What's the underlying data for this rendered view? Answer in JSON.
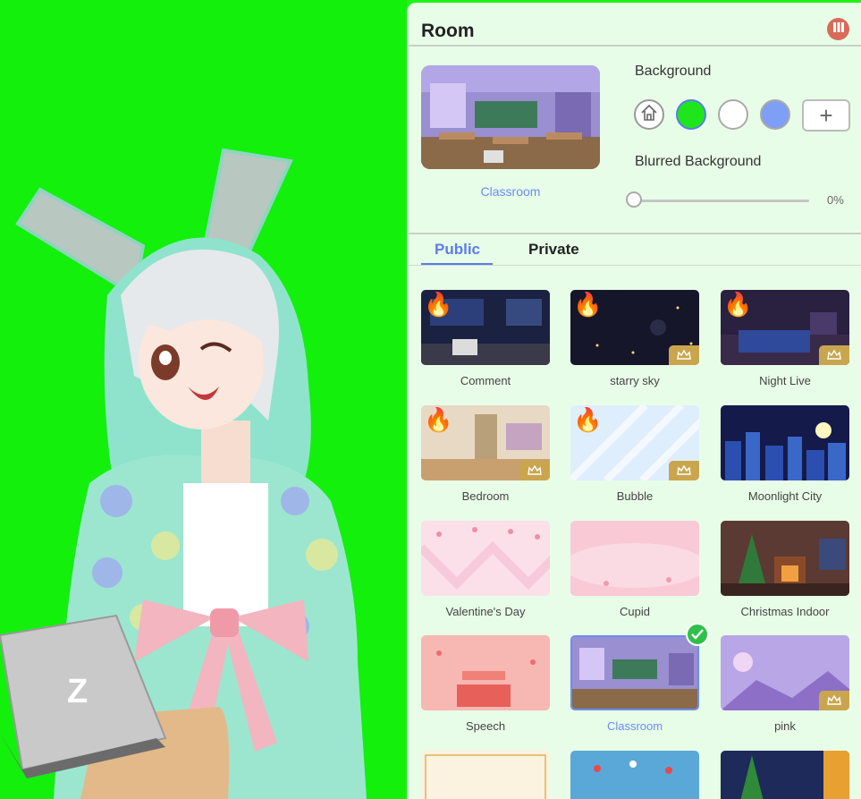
{
  "panel": {
    "title": "Room",
    "preview_label": "Classroom",
    "background_label": "Background",
    "blur_label": "Blurred Background",
    "blur_value_text": "0%",
    "blur_level": 0,
    "swatch_colors": [
      "#ffffff",
      "#1fe61a",
      "#ffffff",
      "#7f9ef5"
    ],
    "accent": "#5a7cf0",
    "add_symbol": "+"
  },
  "tabs": [
    {
      "label": "Public",
      "active": true
    },
    {
      "label": "Private",
      "active": false
    }
  ],
  "rooms": [
    {
      "label": "Comment",
      "hot": true,
      "vip": false
    },
    {
      "label": "starry sky",
      "hot": true,
      "vip": true
    },
    {
      "label": "Night Live",
      "hot": true,
      "vip": true
    },
    {
      "label": "Bedroom",
      "hot": true,
      "vip": true
    },
    {
      "label": "Bubble",
      "hot": true,
      "vip": true
    },
    {
      "label": "Moonlight City",
      "hot": false,
      "vip": false
    },
    {
      "label": "Valentine's Day",
      "hot": false,
      "vip": false
    },
    {
      "label": "Cupid",
      "hot": false,
      "vip": false
    },
    {
      "label": "Christmas Indoor",
      "hot": false,
      "vip": false
    },
    {
      "label": "Speech",
      "hot": false,
      "vip": false
    },
    {
      "label": "Classroom",
      "hot": false,
      "vip": false,
      "selected": true
    },
    {
      "label": "pink",
      "hot": false,
      "vip": true
    }
  ],
  "avatar_stage": {
    "laptop_logo": "Z"
  }
}
